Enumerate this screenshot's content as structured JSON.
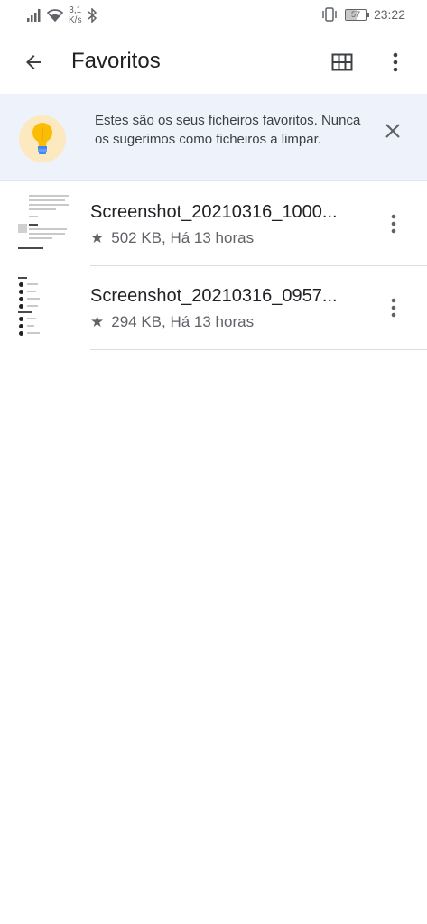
{
  "status_bar": {
    "speed_value": "3,1",
    "speed_unit": "K/s",
    "battery": "57",
    "time": "23:22"
  },
  "app_bar": {
    "title": "Favoritos",
    "back_icon": "arrow-back-icon",
    "grid_icon": "grid-view-icon",
    "more_icon": "more-vert-icon"
  },
  "banner": {
    "icon": "lightbulb-icon",
    "text": "Estes são os seus ficheiros favoritos. Nunca os sugerimos como ficheiros a limpar.",
    "close_icon": "close-icon"
  },
  "files": [
    {
      "name": "Screenshot_20210316_1000...",
      "meta": "502 KB, Há 13 horas"
    },
    {
      "name": "Screenshot_20210316_0957...",
      "meta": "294 KB, Há 13 horas"
    }
  ],
  "colors": {
    "banner_bg": "#eef2fb",
    "bulb_bg": "#fde9bf",
    "text_primary": "#202124",
    "text_secondary": "#5f6368"
  }
}
